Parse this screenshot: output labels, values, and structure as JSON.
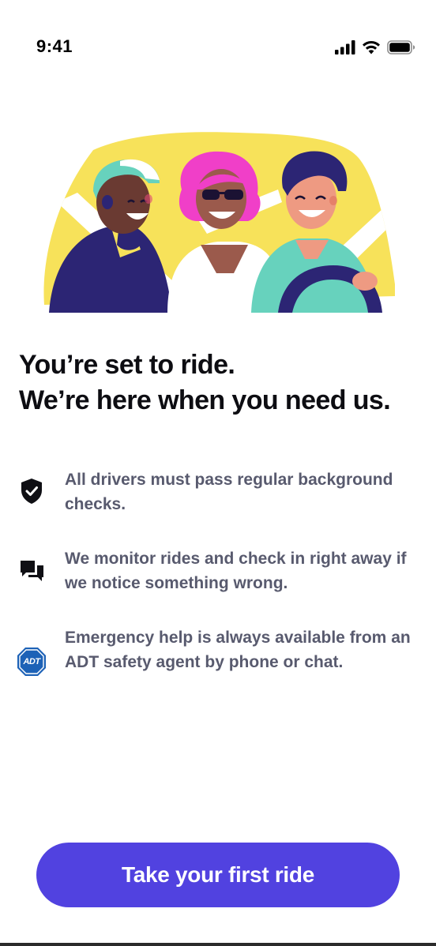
{
  "status_bar": {
    "time": "9:41",
    "icons": [
      "cellular-signal-icon",
      "wifi-icon",
      "battery-icon"
    ]
  },
  "illustration": {
    "name": "three-passengers-riding-illustration",
    "colors": {
      "background": "#f7e25a",
      "purple": "#2c2574",
      "pink": "#f03fc8",
      "teal": "#67d2bd",
      "skin_dark": "#6a3a32",
      "skin_medium": "#9b5a4c",
      "skin_light": "#ee9a82"
    }
  },
  "headline": {
    "line1": "You’re set to ride.",
    "line2": "We’re here when you need us."
  },
  "features": [
    {
      "icon": "shield-check-icon",
      "text": "All drivers must pass regular background checks."
    },
    {
      "icon": "chat-bubbles-icon",
      "text": "We monitor rides and check in right away if we notice something wrong."
    },
    {
      "icon": "adt-logo-icon",
      "icon_text": "ADT",
      "text": "Emergency help is always available from an ADT safety agent by phone or chat."
    }
  ],
  "cta": {
    "label": "Take your first ride"
  },
  "colors": {
    "accent": "#5142e0",
    "body_text": "#585a6e",
    "headline": "#0d0d12",
    "adt_blue": "#1d62b7"
  }
}
